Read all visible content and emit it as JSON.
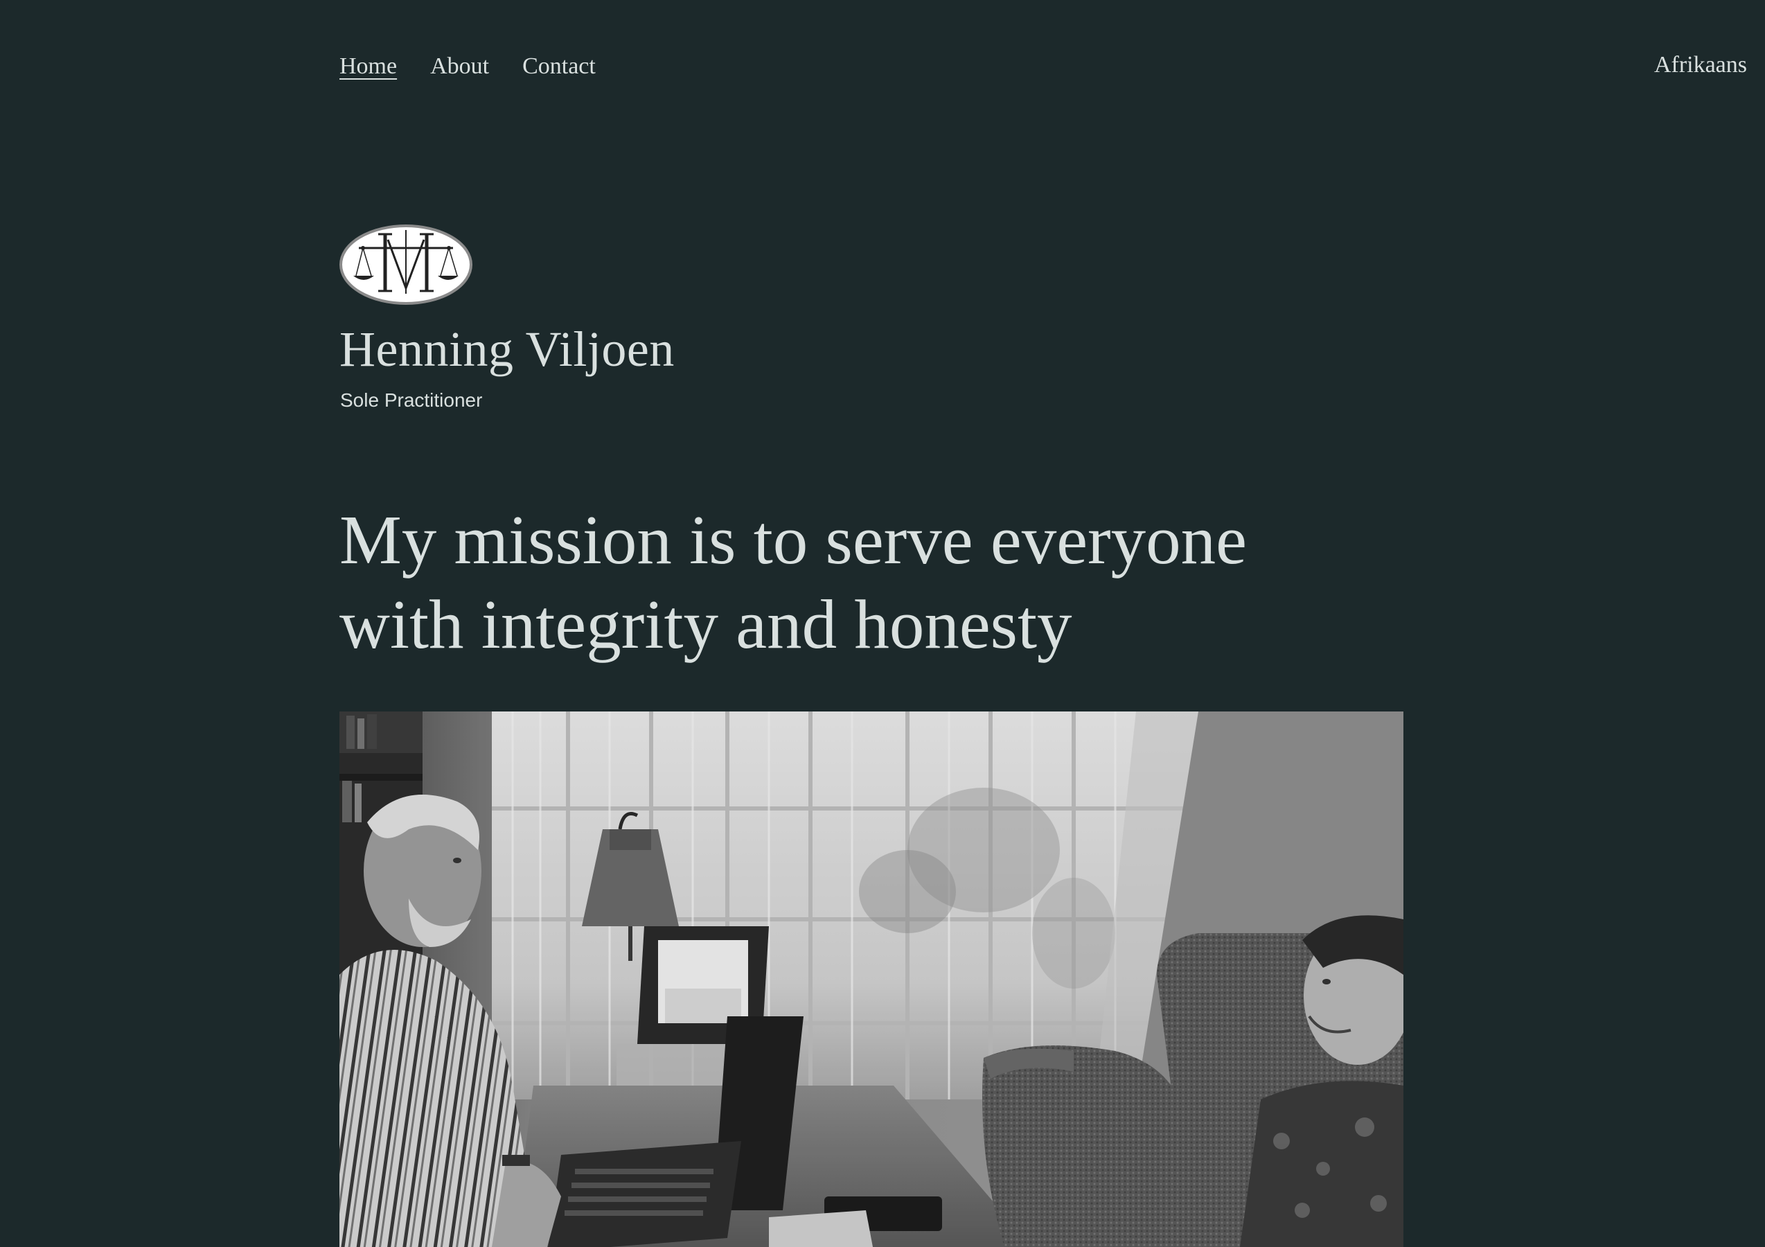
{
  "nav": {
    "items": [
      {
        "label": "Home",
        "current": true
      },
      {
        "label": "About",
        "current": false
      },
      {
        "label": "Contact",
        "current": false
      }
    ],
    "language_link": "Afrikaans"
  },
  "branding": {
    "site_title": "Henning Viljoen",
    "tagline": "Sole Practitioner",
    "logo_icon": "scales-of-justice-monogram-icon"
  },
  "hero": {
    "heading": "My mission is to serve everyone with integrity and honesty",
    "photo_description": "black-and-white photo of an elderly man at a desk with a laptop talking to a young man seated in an armchair"
  },
  "colors": {
    "background": "#1c292b",
    "text": "#d9e0df"
  }
}
